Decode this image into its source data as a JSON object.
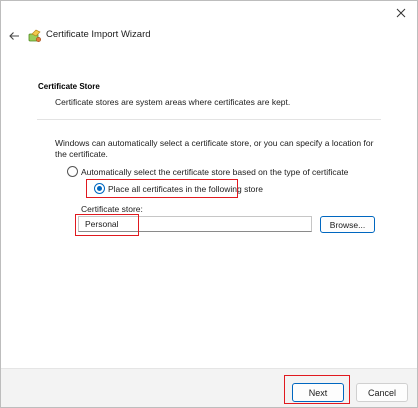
{
  "wizard": {
    "title": "Certificate Import Wizard"
  },
  "section": {
    "title": "Certificate Store",
    "subtitle": "Certificate stores are system areas where certificates are kept."
  },
  "info_text": "Windows can automatically select a certificate store, or you can specify a location for the certificate.",
  "options": {
    "auto_label": "Automatically select the certificate store based on the type of certificate",
    "auto_selected": false,
    "place_label": "Place all certificates in the following store",
    "place_selected": true
  },
  "store": {
    "label": "Certificate store:",
    "value": "Personal",
    "browse_label": "Browse..."
  },
  "footer": {
    "next_label": "Next",
    "cancel_label": "Cancel"
  },
  "icons": {
    "close": "close-icon",
    "back": "back-arrow-icon",
    "wizard": "certificate-icon"
  },
  "colors": {
    "accent": "#0067c0",
    "highlight": "#e0191f"
  }
}
